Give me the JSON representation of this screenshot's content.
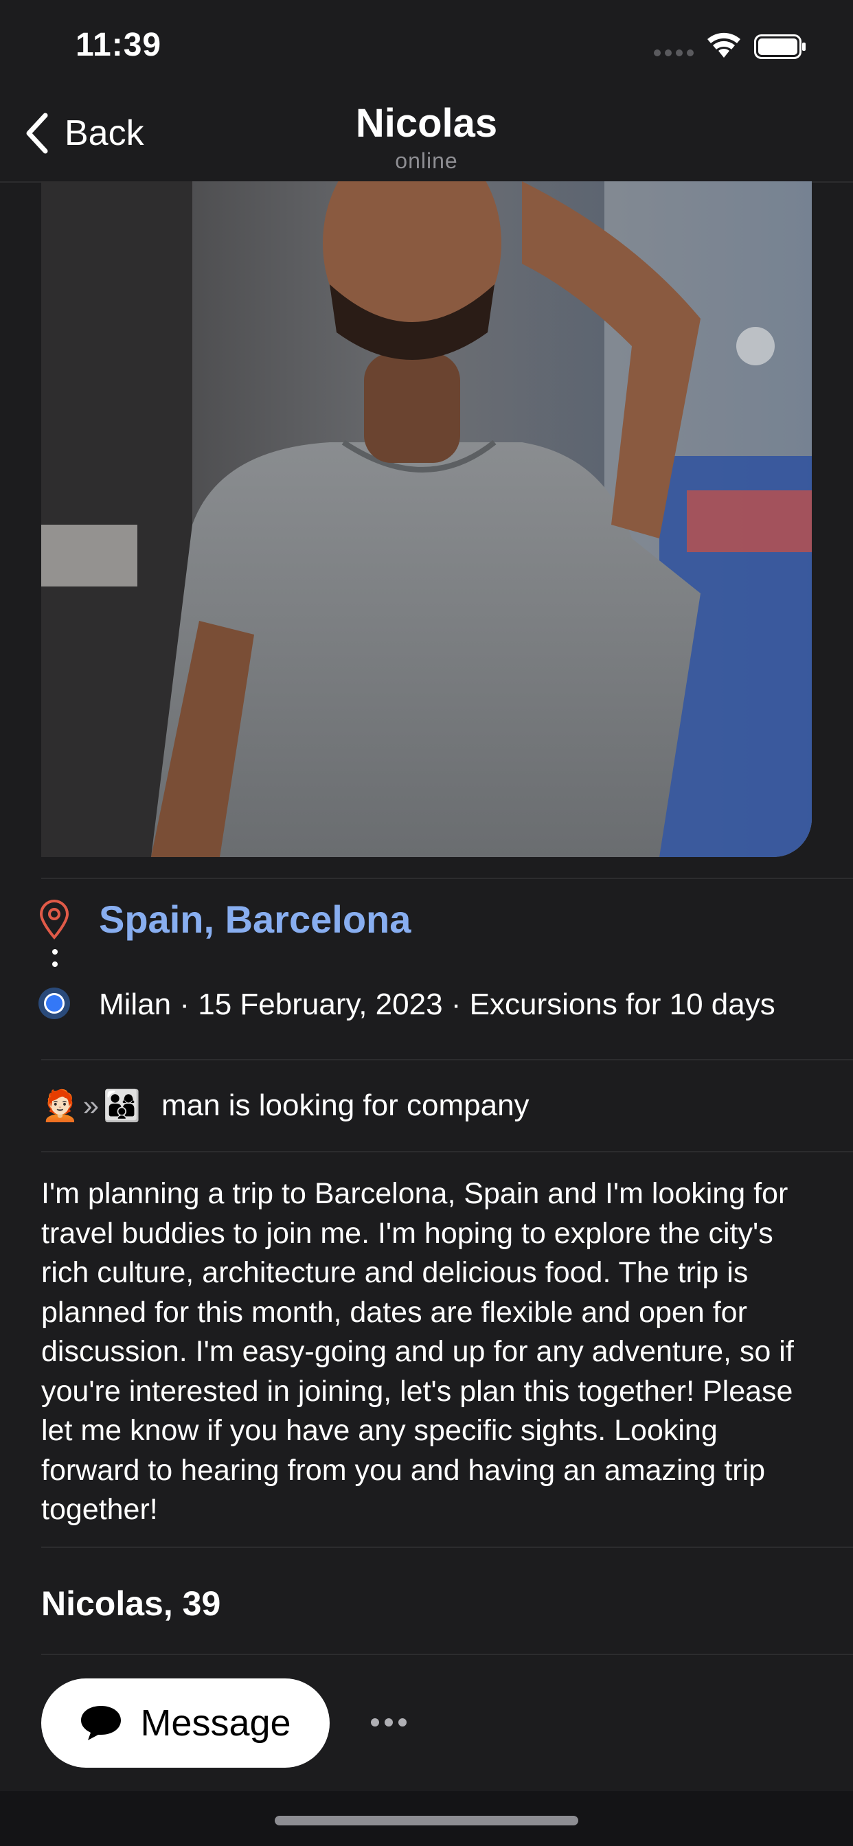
{
  "status": {
    "time": "11:39"
  },
  "nav": {
    "back_label": "Back",
    "title": "Nicolas",
    "subtitle": "online"
  },
  "trip": {
    "destination": "Spain, Barcelona",
    "origin_details": "Milan · 15 February, 2023 · Excursions for 10 days"
  },
  "company": {
    "from_emoji": "🧑🏻‍🦰",
    "separator": "»",
    "to_emoji": "👨‍👩‍👦",
    "label": "man is looking for company"
  },
  "description": "I'm planning a trip to Barcelona, Spain and I'm looking for travel buddies to join me. I'm hoping to explore the city's rich culture, architecture and delicious food. The trip is planned for this month, dates are flexible and open for discussion. I'm easy-going and up for any adventure, so if you're interested in joining, let's plan this together! Please let me know if you have any specific sights. Looking forward to hearing from you and having an amazing trip together!",
  "profile": {
    "name_age": "Nicolas, 39"
  },
  "actions": {
    "message_label": "Message"
  },
  "colors": {
    "background": "#1c1c1e",
    "accent_destination": "#88aef0",
    "pin": "#e05a48",
    "origin_dot": "#3478f6"
  },
  "icons": [
    "chevron-left-icon",
    "location-pin-icon",
    "origin-dot-icon",
    "speech-bubble-icon",
    "more-icon",
    "wifi-icon",
    "battery-icon",
    "signal-icon"
  ]
}
